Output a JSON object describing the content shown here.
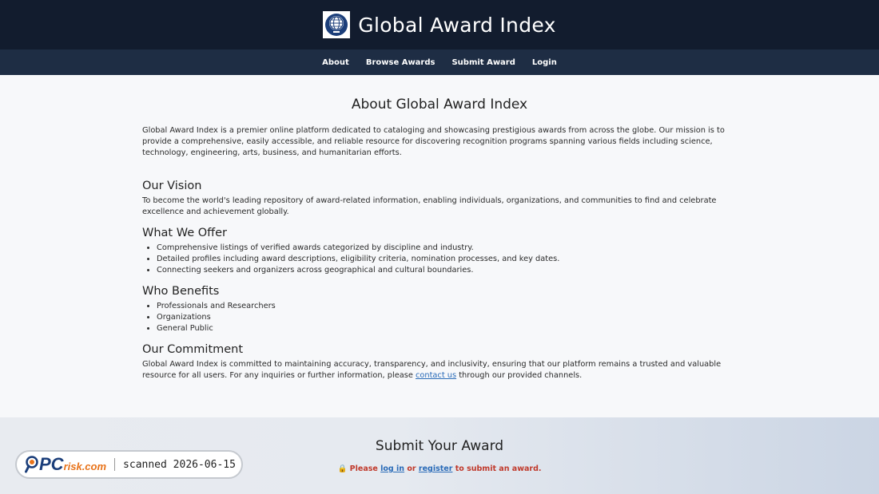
{
  "header": {
    "title": "Global Award Index",
    "logo_icon": "globe-icon"
  },
  "nav": {
    "items": [
      "About",
      "Browse Awards",
      "Submit Award",
      "Login"
    ]
  },
  "about": {
    "title": "About Global Award Index",
    "intro": "Global Award Index is a premier online platform dedicated to cataloging and showcasing prestigious awards from across the globe. Our mission is to provide a comprehensive, easily accessible, and reliable resource for discovering recognition programs spanning various fields including science, technology, engineering, arts, business, and humanitarian efforts.",
    "vision": {
      "heading": "Our Vision",
      "text": "To become the world's leading repository of award-related information, enabling individuals, organizations, and communities to find and celebrate excellence and achievement globally."
    },
    "offer": {
      "heading": "What We Offer",
      "items": [
        "Comprehensive listings of verified awards categorized by discipline and industry.",
        "Detailed profiles including award descriptions, eligibility criteria, nomination processes, and key dates.",
        "Connecting seekers and organizers across geographical and cultural boundaries."
      ]
    },
    "benefits": {
      "heading": "Who Benefits",
      "items": [
        "Professionals and Researchers",
        "Organizations",
        "General Public"
      ]
    },
    "commitment": {
      "heading": "Our Commitment",
      "text_before": "Global Award Index is committed to maintaining accuracy, transparency, and inclusivity, ensuring that our platform remains a trusted and valuable resource for all users. For any inquiries or further information, please ",
      "link": "contact us",
      "text_after": " through our provided channels."
    }
  },
  "submit": {
    "title": "Submit Your Award",
    "lock_icon": "🔒",
    "note_before": " Please ",
    "login_link": "log in",
    "note_mid": " or ",
    "register_link": "register",
    "note_after": " to submit an award."
  },
  "badge": {
    "brand_pc": "PC",
    "brand_risk": "risk.com",
    "scan_text": "scanned 2026-06-15"
  },
  "colors": {
    "header_bg": "#121c2e",
    "nav_bg": "#1e2d44",
    "link": "#2a6bb8",
    "warning": "#c0392b",
    "brand_blue": "#1b3e7a",
    "brand_orange": "#e8731a"
  }
}
